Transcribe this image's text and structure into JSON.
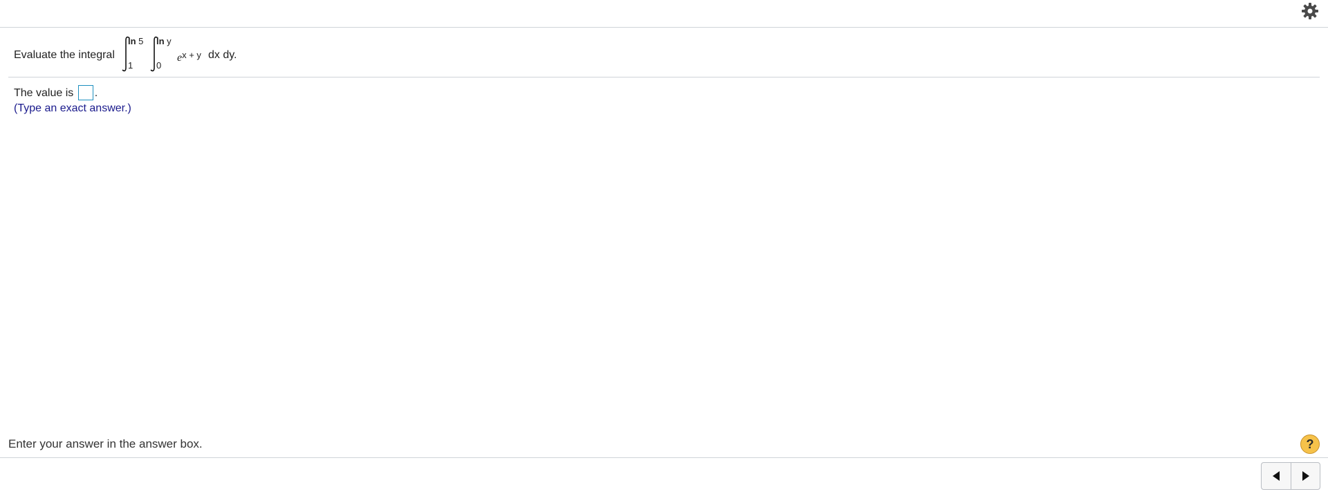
{
  "header": {
    "settings_icon": "gear-icon"
  },
  "question": {
    "prefix": "Evaluate the integral",
    "outer_upper_bold": "ln",
    "outer_upper_rest": " 5",
    "outer_lower": "1",
    "inner_upper_bold": "ln",
    "inner_upper_rest": " y",
    "inner_lower": "0",
    "integrand_base": "e",
    "integrand_exponent": "x + y",
    "suffix": "dx dy."
  },
  "answer": {
    "label": "The value is",
    "value": "",
    "trailing": ".",
    "hint": "(Type an exact answer.)"
  },
  "footer": {
    "instruction": "Enter your answer in the answer box.",
    "help_label": "?",
    "help_icon": "help-icon",
    "prev_icon": "prev-arrow-icon",
    "next_icon": "next-arrow-icon"
  },
  "colors": {
    "hint_text": "#1a1a8c",
    "answer_box_border": "#1c8fbf",
    "help_button": "#f6c24a",
    "divider": "#cfd3d8"
  }
}
